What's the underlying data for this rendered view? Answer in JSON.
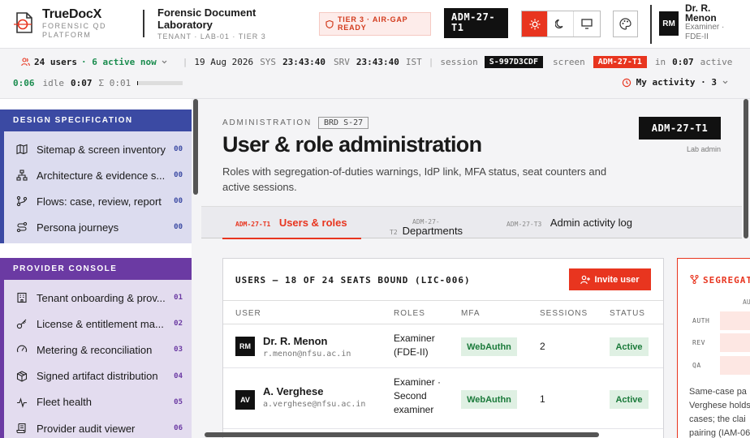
{
  "brand": {
    "name": "TrueDocX",
    "sub1": "FORENSIC QD",
    "sub2": "PLATFORM"
  },
  "lab": {
    "title1": "Forensic Document",
    "title2": "Laboratory",
    "tenant": "TENANT · LAB-01 · TIER 3"
  },
  "tier_badge": {
    "line1": "TIER 3 · AIR-GAP",
    "line2": "READY"
  },
  "screen_tag": {
    "line1": "ADM-27-",
    "line2": "T1"
  },
  "user": {
    "initials": "RM",
    "name1": "Dr. R.",
    "name2": "Menon",
    "role1": "Examiner ·",
    "role2": "FDE-II"
  },
  "statusbar": {
    "users": "24 users",
    "active": "· 6 active now",
    "date": "19 Aug 2026",
    "sys_label": "SYS",
    "sys_time": "23:43:40",
    "srv_label": "SRV",
    "srv_time": "23:43:40",
    "tz": "IST",
    "session_label": "session",
    "session_id": "S-997D3CDF",
    "screen_label": "screen",
    "screen_id": "ADM-27-T1",
    "in_label": "in",
    "in_time": "0:07",
    "active_label": "active",
    "active_time": "0:06",
    "idle_label": "idle",
    "idle_time": "0:07",
    "sum_label": "Σ 0:01",
    "idle_progress": 0.02,
    "my_activity": "My activity · 3"
  },
  "sidebar": {
    "design": {
      "title": "DESIGN SPECIFICATION",
      "color": "#3b4aa3",
      "items": [
        {
          "label": "Sitemap & screen inventory",
          "num": "00",
          "icon": "map-icon"
        },
        {
          "label": "Architecture & evidence s...",
          "num": "00",
          "icon": "architecture-icon"
        },
        {
          "label": "Flows: case, review, report",
          "num": "00",
          "icon": "flow-icon"
        },
        {
          "label": "Persona journeys",
          "num": "00",
          "icon": "route-icon"
        }
      ]
    },
    "provider": {
      "title": "PROVIDER CONSOLE",
      "color": "#6b3aa3",
      "items": [
        {
          "label": "Tenant onboarding & prov...",
          "num": "01",
          "icon": "building-icon"
        },
        {
          "label": "License & entitlement ma...",
          "num": "02",
          "icon": "key-icon"
        },
        {
          "label": "Metering & reconciliation",
          "num": "03",
          "icon": "gauge-icon"
        },
        {
          "label": "Signed artifact distribution",
          "num": "04",
          "icon": "package-icon"
        },
        {
          "label": "Fleet health",
          "num": "05",
          "icon": "pulse-icon"
        },
        {
          "label": "Provider audit viewer",
          "num": "06",
          "icon": "scroll-icon"
        }
      ]
    }
  },
  "page": {
    "kicker": "ADMINISTRATION",
    "brd": "BRD S-27",
    "title": "User & role administration",
    "lead": "Roles with segregation-of-duties warnings, IdP link, MFA status, seat counters and active sessions.",
    "screen_id": "ADM-27-T1",
    "screen_caption": "Lab admin"
  },
  "tabs": [
    {
      "code": "ADM-27-T1",
      "label": "Users & roles"
    },
    {
      "code1": "ADM-27-",
      "code2": "T2",
      "label": "Departments"
    },
    {
      "code": "ADM-27-T3",
      "label": "Admin activity log"
    }
  ],
  "users_card": {
    "title": "USERS — 18 OF 24 SEATS BOUND (LIC-006)",
    "invite": "Invite user",
    "columns": [
      "USER",
      "ROLES",
      "MFA",
      "SESSIONS",
      "STATUS"
    ],
    "rows": [
      {
        "initials": "RM",
        "name": "Dr. R. Menon",
        "email": "r.menon@nfsu.ac.in",
        "role1": "Examiner",
        "role2": "(FDE-II)",
        "role3": "",
        "mfa": "WebAuthn",
        "sessions": "2",
        "status": "Active"
      },
      {
        "initials": "AV",
        "name": "A. Verghese",
        "email": "a.verghese@nfsu.ac.in",
        "role1": "Examiner ·",
        "role2": "Second",
        "role3": "examiner",
        "mfa": "WebAuthn",
        "sessions": "1",
        "status": "Active"
      }
    ]
  },
  "sod_card": {
    "title": "SEGREGATION",
    "col_head": "AU",
    "rows": [
      "AUTH",
      "REV",
      "QA"
    ],
    "note1": "Same-case pa",
    "note2": "Verghese holds",
    "note3": "cases; the clai",
    "note4": "pairing (IAM-06"
  }
}
